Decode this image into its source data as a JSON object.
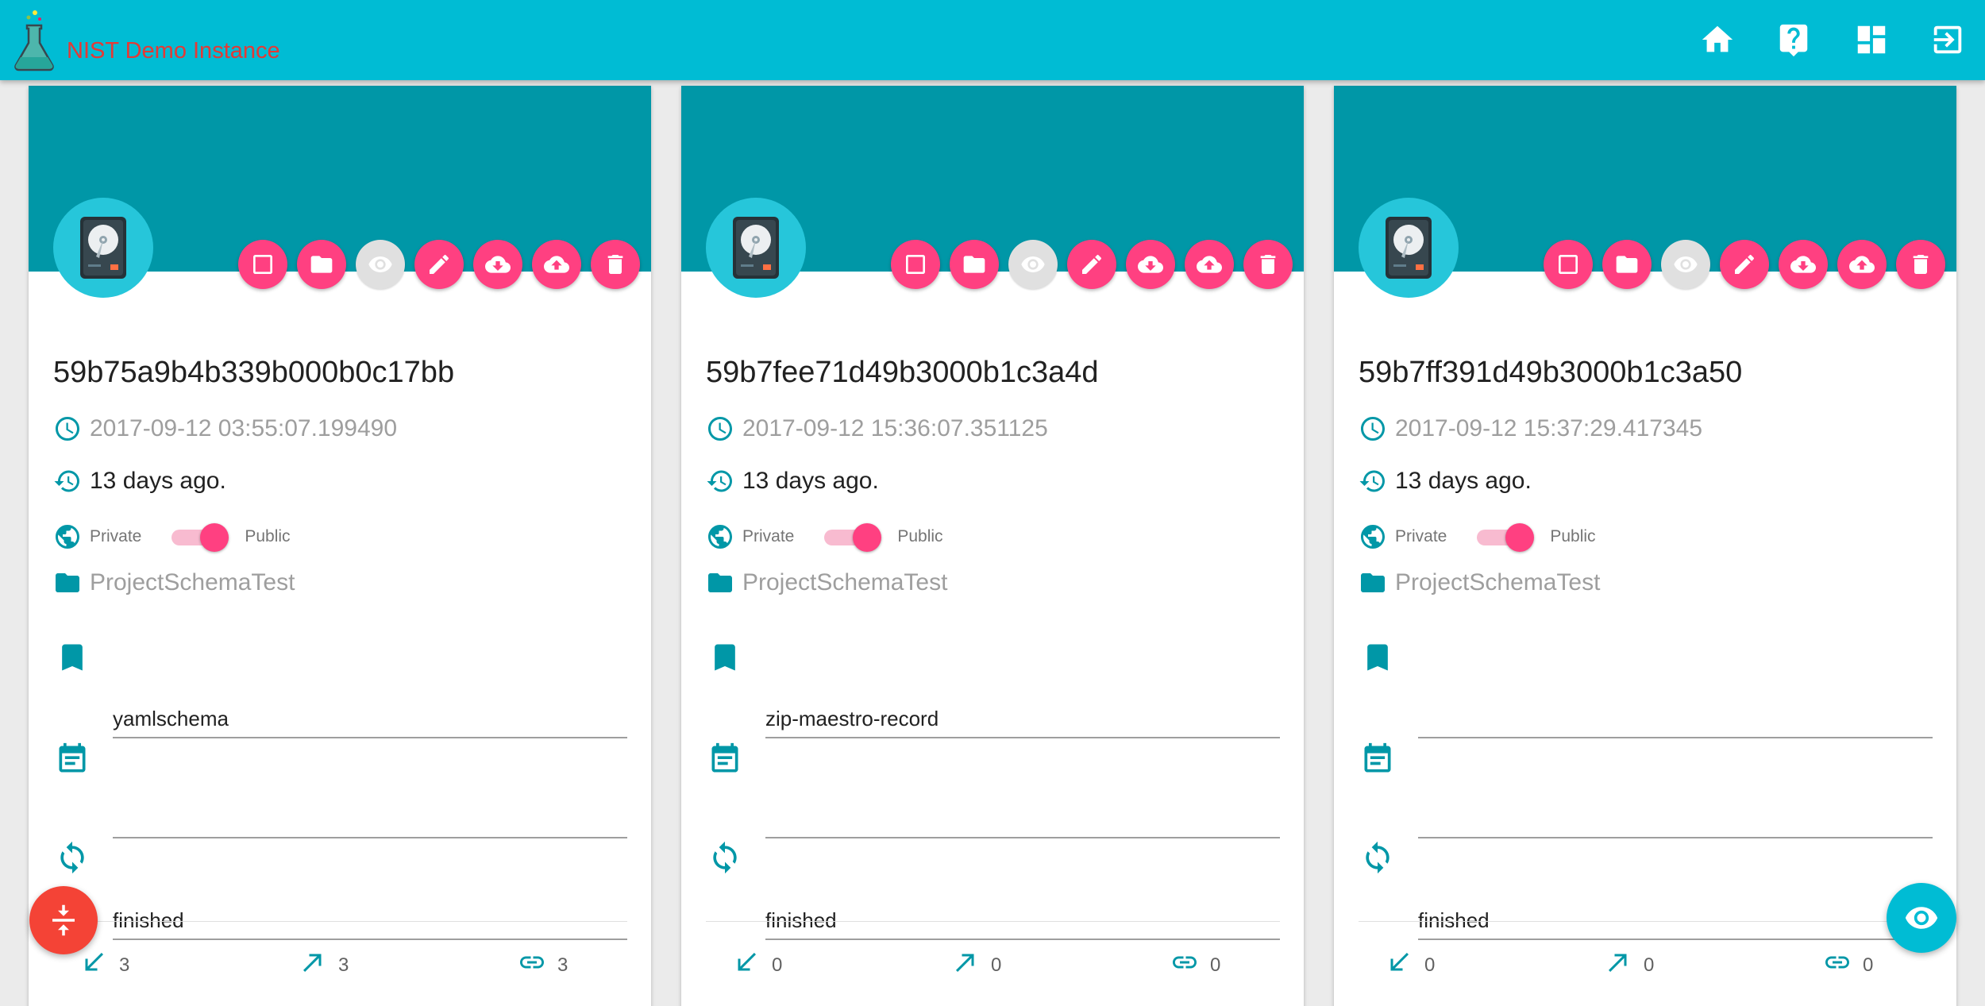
{
  "header": {
    "app_title": "NIST Demo Instance",
    "nav_icons": [
      "home-icon",
      "help-icon",
      "dashboard-icon",
      "logout-icon"
    ]
  },
  "colors": {
    "toolbar": "#00bcd4",
    "card_header": "#0097a7",
    "accent": "#ff4081",
    "title_red": "#e53935",
    "collapse_fab": "#f44336"
  },
  "action_icons": [
    "select-icon",
    "folder-icon",
    "view-icon",
    "edit-icon",
    "download-icon",
    "upload-icon",
    "delete-icon"
  ],
  "cards": [
    {
      "id": "59b75a9b4b339b000b0c17bb",
      "timestamp": "2017-09-12 03:55:07.199490",
      "ago": "13 days ago.",
      "private_label": "Private",
      "public_label": "Public",
      "is_public": true,
      "project": "ProjectSchemaTest",
      "schema": "yamlschema",
      "calendar_value": "",
      "status": "finished",
      "stats": {
        "incoming": "3",
        "outgoing": "3",
        "links": "3"
      }
    },
    {
      "id": "59b7fee71d49b3000b1c3a4d",
      "timestamp": "2017-09-12 15:36:07.351125",
      "ago": "13 days ago.",
      "private_label": "Private",
      "public_label": "Public",
      "is_public": true,
      "project": "ProjectSchemaTest",
      "schema": "zip-maestro-record",
      "calendar_value": "",
      "status": "finished",
      "stats": {
        "incoming": "0",
        "outgoing": "0",
        "links": "0"
      }
    },
    {
      "id": "59b7ff391d49b3000b1c3a50",
      "timestamp": "2017-09-12 15:37:29.417345",
      "ago": "13 days ago.",
      "private_label": "Private",
      "public_label": "Public",
      "is_public": true,
      "project": "ProjectSchemaTest",
      "schema": "",
      "calendar_value": "",
      "status": "finished",
      "stats": {
        "incoming": "0",
        "outgoing": "0",
        "links": "0"
      }
    }
  ],
  "fabs": {
    "left_icon": "collapse-icon",
    "right_icon": "eye-icon"
  }
}
